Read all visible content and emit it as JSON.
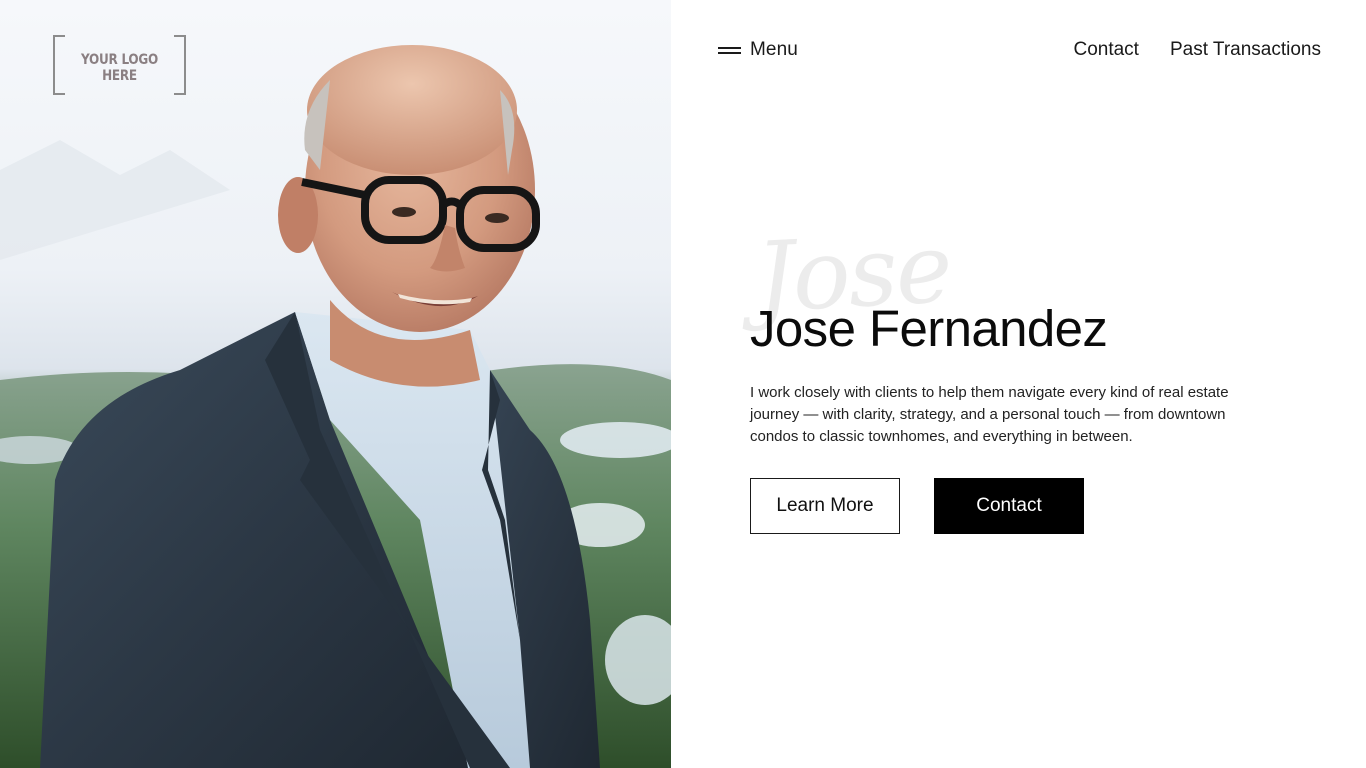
{
  "logo": {
    "text": "YOUR LOGO HERE"
  },
  "nav": {
    "menu_label": "Menu",
    "links": [
      {
        "label": "Contact"
      },
      {
        "label": "Past Transactions"
      }
    ]
  },
  "hero": {
    "script_watermark": "Jose",
    "name": "Jose Fernandez",
    "description": "I work closely with clients to help them navigate every kind of real estate journey — with clarity, strategy, and a personal touch — from downtown condos to classic townhomes, and everything in between.",
    "buttons": {
      "learn_more": "Learn More",
      "contact": "Contact"
    }
  },
  "colors": {
    "text": "#0b0b0b",
    "button_solid_bg": "#000000",
    "button_solid_text": "#ffffff",
    "logo_gray": "#8a7f82",
    "watermark": "#ececec"
  },
  "icons": {
    "menu": "hamburger-icon"
  }
}
